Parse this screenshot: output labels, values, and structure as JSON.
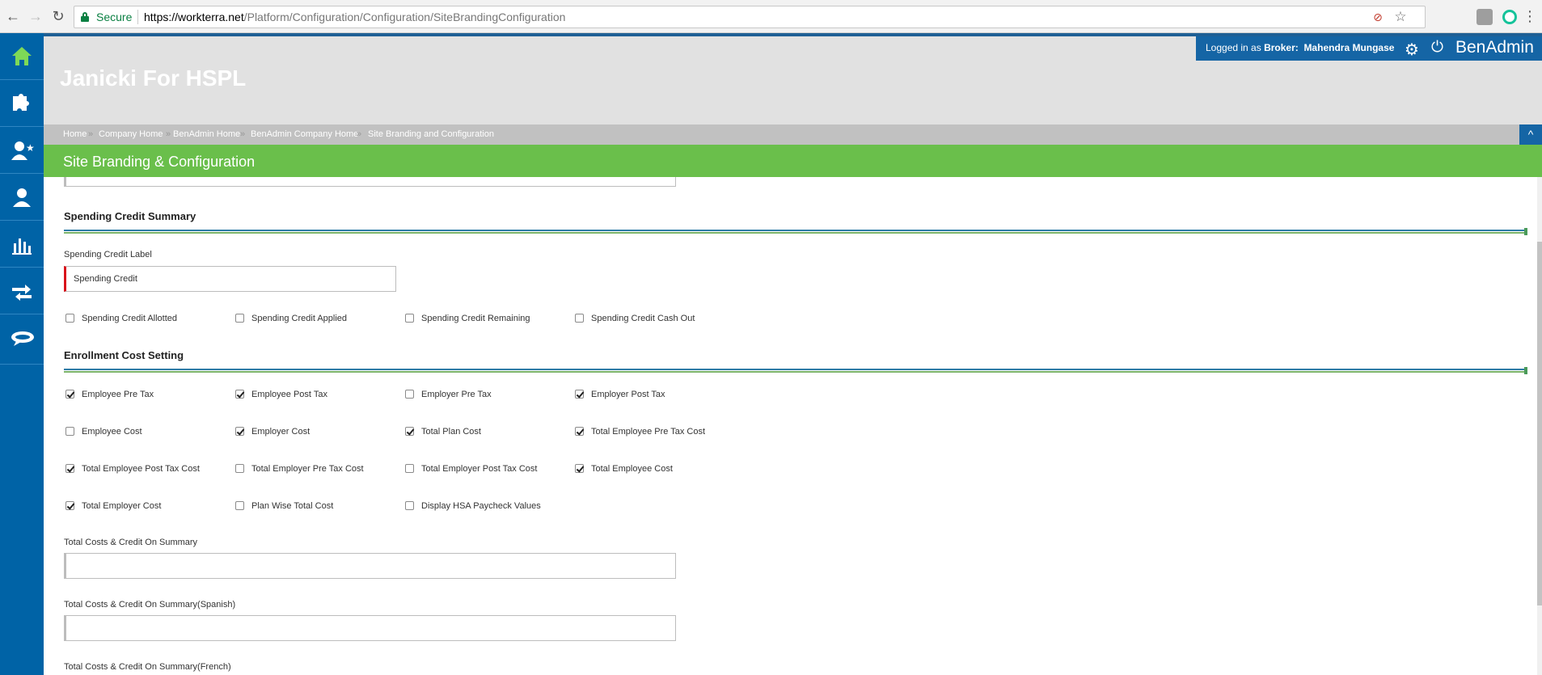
{
  "browser": {
    "back": "←",
    "forward": "→",
    "reload": "↻",
    "secure": "Secure",
    "url_host": "https://workterra.net",
    "url_path": "/Platform/Configuration/Configuration/SiteBrandingConfiguration",
    "star": "☆",
    "menu": "⋮"
  },
  "header": {
    "brand": "Janicki For HSPL",
    "login_prefix": "Logged in as",
    "login_role": "Broker:",
    "login_user": "Mahendra Mungase",
    "app_name": "BenAdmin",
    "gear": "⚙",
    "power": "⏻"
  },
  "breadcrumbs": [
    "Home",
    "Company Home",
    "BenAdmin Home",
    "BenAdmin Company Home",
    "Site Branding and Configuration"
  ],
  "breadcrumb_sep": "»",
  "collapse": "^",
  "page_title": "Site Branding & Configuration",
  "spending": {
    "title": "Spending Credit Summary",
    "label_field": "Spending Credit Label",
    "label_value": "Spending Credit",
    "checkboxes": [
      {
        "label": "Spending Credit Allotted",
        "checked": false
      },
      {
        "label": "Spending Credit Applied",
        "checked": false
      },
      {
        "label": "Spending Credit Remaining",
        "checked": false
      },
      {
        "label": "Spending Credit Cash Out",
        "checked": false
      }
    ]
  },
  "enrollment": {
    "title": "Enrollment Cost Setting",
    "rows": [
      [
        {
          "label": "Employee Pre Tax",
          "checked": true
        },
        {
          "label": "Employee Post Tax",
          "checked": true
        },
        {
          "label": "Employer Pre Tax",
          "checked": false
        },
        {
          "label": "Employer Post Tax",
          "checked": true
        }
      ],
      [
        {
          "label": "Employee Cost",
          "checked": false
        },
        {
          "label": "Employer Cost",
          "checked": true
        },
        {
          "label": "Total Plan Cost",
          "checked": true
        },
        {
          "label": "Total Employee Pre Tax Cost",
          "checked": true
        }
      ],
      [
        {
          "label": "Total Employee Post Tax Cost",
          "checked": true
        },
        {
          "label": "Total Employer Pre Tax Cost",
          "checked": false
        },
        {
          "label": "Total Employer Post Tax Cost",
          "checked": false
        },
        {
          "label": "Total Employee Cost",
          "checked": true
        }
      ],
      [
        {
          "label": "Total Employer Cost",
          "checked": true
        },
        {
          "label": "Plan Wise Total Cost",
          "checked": false
        },
        {
          "label": "Display HSA Paycheck Values",
          "checked": false
        }
      ]
    ]
  },
  "fields": [
    {
      "label": "Total Costs & Credit On Summary",
      "value": ""
    },
    {
      "label": "Total Costs & Credit On Summary(Spanish)",
      "value": ""
    },
    {
      "label": "Total Costs & Credit On Summary(French)",
      "value": ""
    }
  ],
  "colors": {
    "sidebar": "#0063a6",
    "title_bar": "#6abf4b",
    "required": "#d9121b"
  },
  "sidebar_icons": [
    "home-icon",
    "puzzle-icon",
    "user-star-icon",
    "user-icon",
    "bar-chart-icon",
    "transfer-arrows-icon",
    "chat-bubble-icon"
  ]
}
